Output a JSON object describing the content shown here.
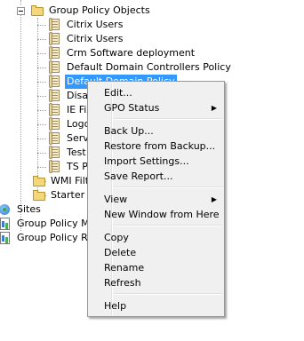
{
  "tree": {
    "root_label": "Group Policy Objects",
    "gpos": [
      "Citrix Users",
      "Citrix Users",
      "Crm Software deployment",
      "Default Domain Controllers Policy",
      "Default Domain Policy",
      "Disab",
      "IE Fix",
      "Logon",
      "Serv",
      "Test",
      "TS Pr"
    ],
    "selected_index": 4,
    "after_gpos": [
      "WMI Filte",
      "Starter G"
    ],
    "bottom_nodes": [
      "Sites",
      "Group Policy Mod",
      "Group Policy Res"
    ]
  },
  "context_menu": {
    "groups": [
      [
        {
          "label": "Edit...",
          "submenu": false
        },
        {
          "label": "GPO Status",
          "submenu": true
        }
      ],
      [
        {
          "label": "Back Up...",
          "submenu": false
        },
        {
          "label": "Restore from Backup...",
          "submenu": false
        },
        {
          "label": "Import Settings...",
          "submenu": false
        },
        {
          "label": "Save Report...",
          "submenu": false
        }
      ],
      [
        {
          "label": "View",
          "submenu": true
        },
        {
          "label": "New Window from Here",
          "submenu": false
        }
      ],
      [
        {
          "label": "Copy",
          "submenu": false
        },
        {
          "label": "Delete",
          "submenu": false
        },
        {
          "label": "Rename",
          "submenu": false
        },
        {
          "label": "Refresh",
          "submenu": false
        }
      ],
      [
        {
          "label": "Help",
          "submenu": false
        }
      ]
    ]
  },
  "icons": {
    "container": "folder-icon",
    "gpo": "gpo-scroll-icon",
    "sites": "globe-icon",
    "tool": "report-icon",
    "submenu_arrow": "chevron-right-icon"
  }
}
